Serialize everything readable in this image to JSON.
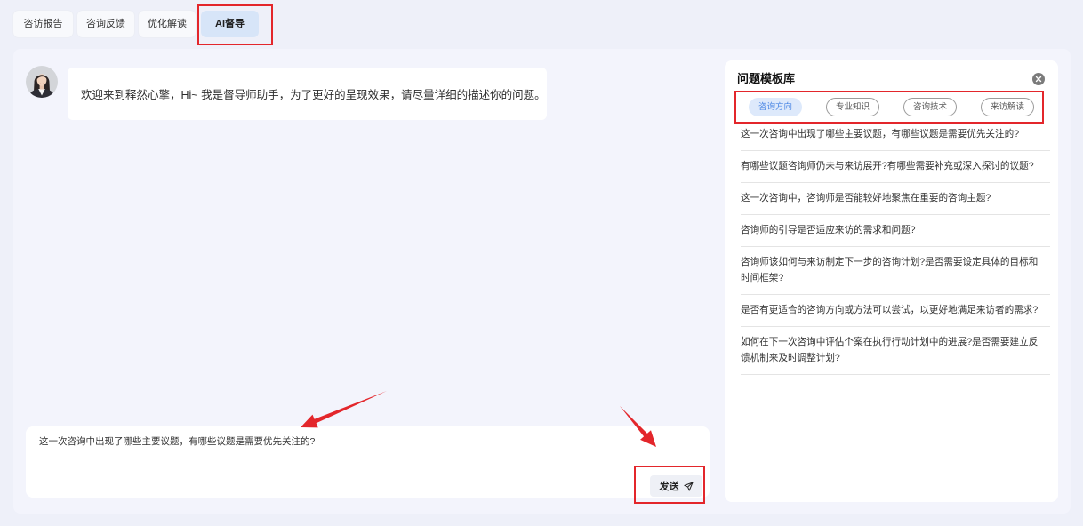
{
  "top_tabs": [
    {
      "label": "咨访报告",
      "active": false
    },
    {
      "label": "咨询反馈",
      "active": false
    },
    {
      "label": "优化解读",
      "active": false
    },
    {
      "label": "AI督导",
      "active": true
    }
  ],
  "chat": {
    "avatar_icon": "assistant-avatar",
    "messages": [
      {
        "text": "欢迎来到释然心擎，Hi~ 我是督导师助手，为了更好的呈现效果，请尽量详细的描述你的问题。"
      }
    ],
    "composer": {
      "value": "这一次咨询中出现了哪些主要议题，有哪些议题是需要优先关注的?",
      "send_label": "发送",
      "send_icon": "paper-plane-icon"
    }
  },
  "template_library": {
    "title": "问题模板库",
    "close_icon": "close-icon",
    "tabs": [
      {
        "label": "咨询方向",
        "active": true
      },
      {
        "label": "专业知识",
        "active": false
      },
      {
        "label": "咨询技术",
        "active": false
      },
      {
        "label": "来访解读",
        "active": false
      }
    ],
    "questions": [
      "这一次咨询中出现了哪些主要议题，有哪些议题是需要优先关注的?",
      "有哪些议题咨询师仍未与来访展开?有哪些需要补充或深入探讨的议题?",
      "这一次咨询中，咨询师是否能较好地聚焦在重要的咨询主题?",
      "咨询师的引导是否适应来访的需求和问题?",
      "咨询师该如何与来访制定下一步的咨询计划?是否需要设定具体的目标和时间框架?",
      "是否有更适合的咨询方向或方法可以尝试，以更好地满足来访者的需求?",
      "如何在下一次咨询中评估个案在执行行动计划中的进展?是否需要建立反馈机制来及时调整计划?"
    ]
  },
  "colors": {
    "page_background": "#eef0f9",
    "panel_background": "#f3f4fc",
    "active_tab_background": "#d7e5f8",
    "template_tab_active_background": "#dde9fb",
    "template_tab_active_text": "#4a86e4",
    "annotation_red": "#e3262b"
  }
}
